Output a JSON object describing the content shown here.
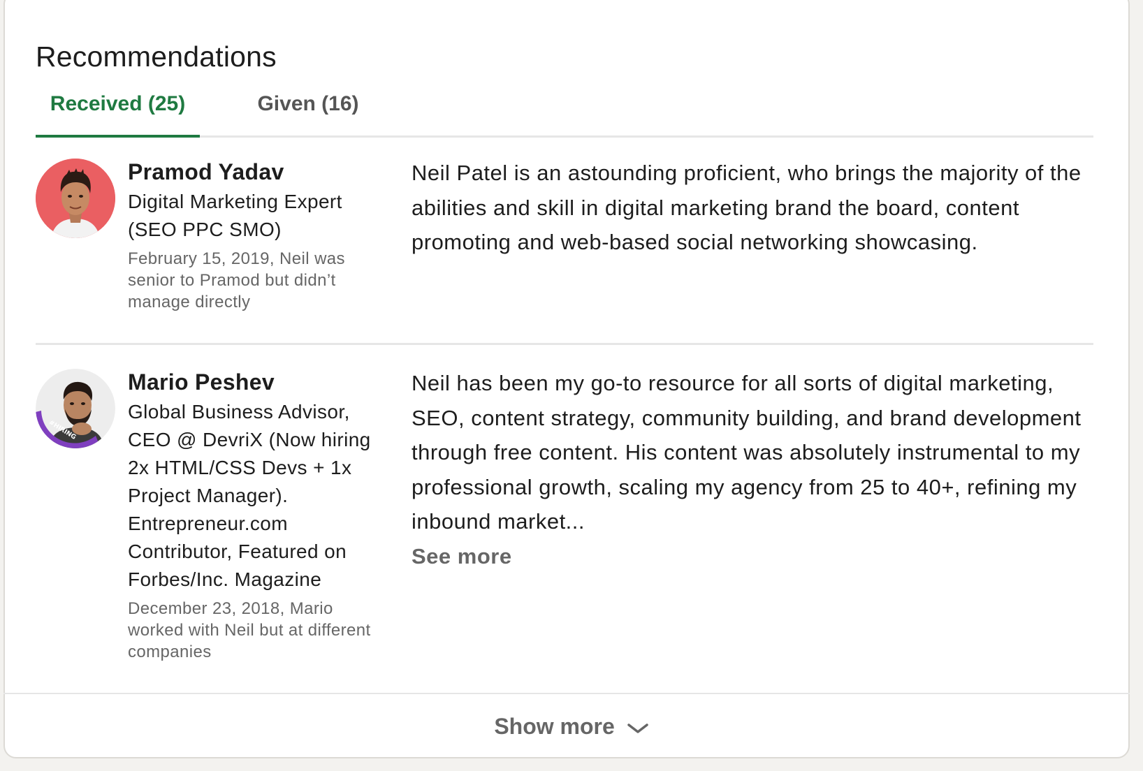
{
  "section": {
    "title": "Recommendations"
  },
  "tabs": [
    {
      "label": "Received (25)",
      "active": true
    },
    {
      "label": "Given (16)",
      "active": false
    }
  ],
  "recommendations": [
    {
      "name": "Pramod Yadav",
      "headline": "Digital Marketing Expert (SEO PPC SMO)",
      "relationship": "February 15, 2019, Neil was senior to Pramod but didn’t manage directly",
      "text": "Neil Patel is an astounding proficient, who brings the majority of the abilities and skill in digital marketing brand the board, content promoting and web-based social networking showcasing.",
      "avatar": {
        "icon": "profile-photo",
        "bg": "#e6585b"
      }
    },
    {
      "name": "Mario Peshev",
      "headline": "Global Business Advisor, CEO @ DevriX (Now hiring 2x HTML/CSS Devs + 1x Project Manager). Entrepreneur.com Contributor, Featured on Forbes/Inc. Magazine",
      "relationship": "December 23, 2018, Mario worked with Neil but at different companies",
      "text": "Neil has been my go-to resource for all sorts of digital marketing, SEO, content strategy, community building, and brand development through free content. His content was absolutely instrumental to my professional growth, scaling my agency from 25 to 40+, refining my inbound market...",
      "see_more": "See more",
      "avatar": {
        "icon": "profile-photo",
        "badge": "#HIRING",
        "ring": "#7f3fbf"
      }
    }
  ],
  "footer": {
    "show_more": "Show more",
    "icon": "chevron-down-icon"
  },
  "colors": {
    "accent": "#1f7a41",
    "muted": "#666666",
    "divider": "#e6e6e6",
    "background": "#f3f2ef"
  }
}
